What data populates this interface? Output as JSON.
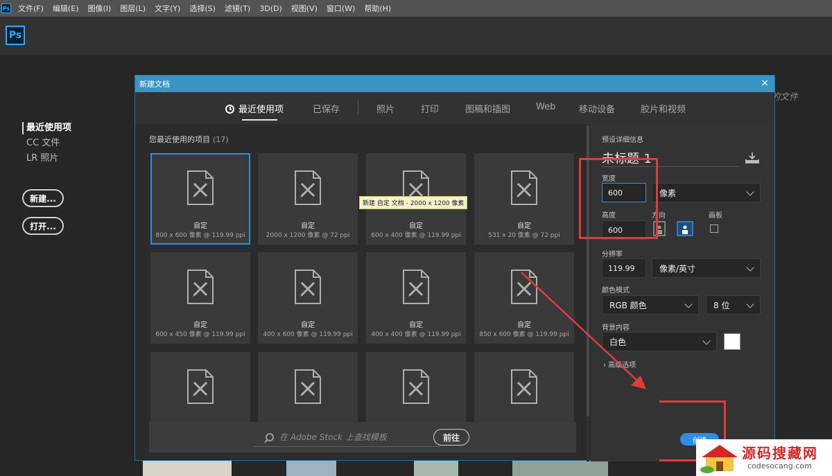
{
  "menubar": {
    "app_icon": "Ps",
    "items": [
      "文件(F)",
      "编辑(E)",
      "图像(I)",
      "图层(L)",
      "文字(Y)",
      "选择(S)",
      "滤镜(T)",
      "3D(D)",
      "视图(V)",
      "窗口(W)",
      "帮助(H)"
    ]
  },
  "app": {
    "logo": "Ps"
  },
  "start": {
    "nav": [
      "最近使用项",
      "CC 文件",
      "LR 照片"
    ],
    "new_label": "新建...",
    "open_label": "打开...",
    "recent_files_partial": "的文件"
  },
  "dialog": {
    "title": "新建文档",
    "close_glyph": "×",
    "tabs": [
      "最近使用项",
      "已保存",
      "照片",
      "打印",
      "图稿和插图",
      "Web",
      "移动设备",
      "胶片和视频"
    ],
    "recent_heading": "您最近使用的项目",
    "recent_count": "(17)",
    "cards": [
      {
        "name": "自定",
        "info": "800 x 600 像素 @ 119.99 ppi",
        "selected": true
      },
      {
        "name": "自定",
        "info": "2000 x 1200 像素 @ 72 ppi"
      },
      {
        "name": "自定",
        "info": "600 x 400 像素 @ 119.99 ppi"
      },
      {
        "name": "自定",
        "info": "531 x 20 像素 @ 72 ppi"
      },
      {
        "name": "自定",
        "info": "600 x 450 像素 @ 119.99 ppi"
      },
      {
        "name": "自定",
        "info": "400 x 600 像素 @ 119.99 ppi"
      },
      {
        "name": "自定",
        "info": "400 x 400 像素 @ 119.99 ppi"
      },
      {
        "name": "自定",
        "info": "850 x 600 像素 @ 119.99 ppi"
      },
      {
        "name": "",
        "info": ""
      },
      {
        "name": "",
        "info": ""
      },
      {
        "name": "",
        "info": ""
      },
      {
        "name": "",
        "info": ""
      }
    ],
    "tooltip": "新建 自定 文档 - 2000 x 1200 像素",
    "stock": {
      "placeholder": "在 Adobe Stock 上查找模板",
      "go_label": "前往"
    },
    "details": {
      "heading": "预设详细信息",
      "doc_name": "未标题-1",
      "width_label": "宽度",
      "width_value": "600",
      "width_unit": "像素",
      "height_label": "高度",
      "height_value": "600",
      "orientation_label": "方向",
      "artboard_label": "画板",
      "resolution_label": "分辨率",
      "resolution_value": "119.99",
      "resolution_unit": "像素/英寸",
      "color_mode_label": "颜色模式",
      "color_mode": "RGB 颜色",
      "bit_depth": "8 位",
      "background_label": "背景内容",
      "background": "白色",
      "background_color": "#ffffff",
      "advanced_label": "高级选项",
      "create_label": "创建"
    }
  },
  "annotation_color": "#e23b3b",
  "watermark": {
    "title": "源码搜藏网",
    "url": "codesocang.com"
  }
}
